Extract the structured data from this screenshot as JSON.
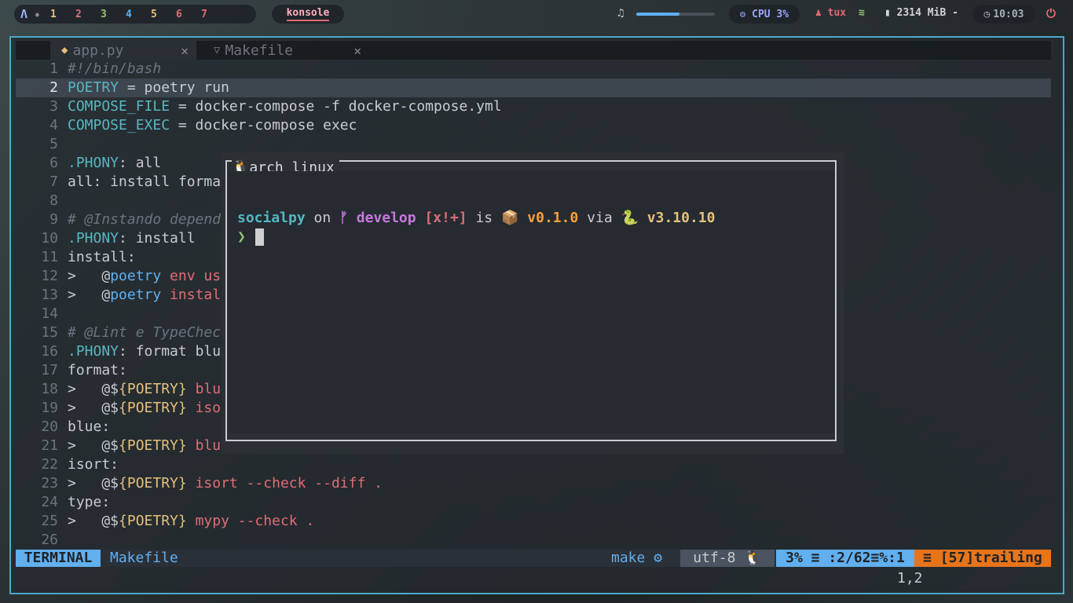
{
  "topbar": {
    "workspaces": [
      "1",
      "2",
      "3",
      "4",
      "5",
      "6",
      "7"
    ],
    "workspace_colors": [
      "#e5c07b",
      "#e06c75",
      "#98c379",
      "#61afef",
      "#e5c07b",
      "#e06c75",
      "#e06c75"
    ],
    "window_title": "konsole",
    "volume_level": 0.55,
    "cpu": "CPU 3%",
    "user": "tux",
    "memory": "2314 MiB -",
    "time": "10:03"
  },
  "editor": {
    "tabs": [
      {
        "label": "app.py",
        "icon": "python-icon"
      },
      {
        "label": "Makefile",
        "icon": "makefile-icon"
      }
    ],
    "lines": [
      {
        "n": "1",
        "segs": [
          {
            "t": "#!/bin/bash",
            "c": "cm"
          }
        ]
      },
      {
        "n": "2",
        "cur": true,
        "segs": [
          {
            "t": "POETRY",
            "c": "vr"
          },
          {
            "t": " = poetry run",
            "c": "pl"
          }
        ]
      },
      {
        "n": "3",
        "segs": [
          {
            "t": "COMPOSE_FILE",
            "c": "vr"
          },
          {
            "t": " = docker-compose -f docker-compose.yml",
            "c": "pl"
          }
        ]
      },
      {
        "n": "4",
        "segs": [
          {
            "t": "COMPOSE_EXEC",
            "c": "vr"
          },
          {
            "t": " = docker-compose exec",
            "c": "pl"
          }
        ]
      },
      {
        "n": "5",
        "segs": []
      },
      {
        "n": "6",
        "segs": [
          {
            "t": ".PHONY",
            "c": "vr"
          },
          {
            "t": ": all",
            "c": "pl"
          }
        ]
      },
      {
        "n": "7",
        "segs": [
          {
            "t": "all: install forma",
            "c": "pl"
          }
        ]
      },
      {
        "n": "8",
        "segs": []
      },
      {
        "n": "9",
        "segs": [
          {
            "t": "# @Instando depend",
            "c": "cm"
          }
        ]
      },
      {
        "n": "10",
        "segs": [
          {
            "t": ".PHONY",
            "c": "vr"
          },
          {
            "t": ": install",
            "c": "pl"
          }
        ]
      },
      {
        "n": "11",
        "segs": [
          {
            "t": "install:",
            "c": "pl"
          }
        ]
      },
      {
        "n": "12",
        "segs": [
          {
            "t": ">   @",
            "c": "pl"
          },
          {
            "t": "poetry",
            "c": "fn"
          },
          {
            "t": " env us",
            "c": "rd"
          }
        ]
      },
      {
        "n": "13",
        "segs": [
          {
            "t": ">   @",
            "c": "pl"
          },
          {
            "t": "poetry",
            "c": "fn"
          },
          {
            "t": " instal",
            "c": "rd"
          }
        ]
      },
      {
        "n": "14",
        "segs": []
      },
      {
        "n": "15",
        "segs": [
          {
            "t": "# @Lint e TypeChec",
            "c": "cm"
          }
        ]
      },
      {
        "n": "16",
        "segs": [
          {
            "t": ".PHONY",
            "c": "vr"
          },
          {
            "t": ": format blu",
            "c": "pl"
          }
        ]
      },
      {
        "n": "17",
        "segs": [
          {
            "t": "format:",
            "c": "pl"
          }
        ]
      },
      {
        "n": "18",
        "segs": [
          {
            "t": ">   @$",
            "c": "pl"
          },
          {
            "t": "{POETRY}",
            "c": "yl"
          },
          {
            "t": " blu",
            "c": "rd"
          }
        ]
      },
      {
        "n": "19",
        "segs": [
          {
            "t": ">   @$",
            "c": "pl"
          },
          {
            "t": "{POETRY}",
            "c": "yl"
          },
          {
            "t": " iso",
            "c": "rd"
          }
        ]
      },
      {
        "n": "20",
        "segs": [
          {
            "t": "blue:",
            "c": "pl"
          }
        ]
      },
      {
        "n": "21",
        "segs": [
          {
            "t": ">   @$",
            "c": "pl"
          },
          {
            "t": "{POETRY}",
            "c": "yl"
          },
          {
            "t": " blu",
            "c": "rd"
          }
        ]
      },
      {
        "n": "22",
        "segs": [
          {
            "t": "isort:",
            "c": "pl"
          }
        ]
      },
      {
        "n": "23",
        "segs": [
          {
            "t": ">   @$",
            "c": "pl"
          },
          {
            "t": "{POETRY}",
            "c": "yl"
          },
          {
            "t": " isort --check --diff .",
            "c": "rd"
          }
        ]
      },
      {
        "n": "24",
        "segs": [
          {
            "t": "type:",
            "c": "pl"
          }
        ]
      },
      {
        "n": "25",
        "segs": [
          {
            "t": ">   @$",
            "c": "pl"
          },
          {
            "t": "{POETRY}",
            "c": "yl"
          },
          {
            "t": " mypy --check .",
            "c": "rd"
          }
        ]
      },
      {
        "n": "26",
        "segs": []
      }
    ]
  },
  "floating_terminal": {
    "title": "arch linux",
    "project": "socialpy",
    "on": "on",
    "branch_icon": "ᚠ",
    "branch": "develop",
    "git_status": "[x!+]",
    "is": "is",
    "package_icon": "📦",
    "version": "v0.1.0",
    "via": "via",
    "python_icon": "🐍",
    "python_version": "v3.10.10",
    "prompt_char": "❯"
  },
  "statusline": {
    "mode": "TERMINAL",
    "filename": "Makefile",
    "filetype": "make",
    "encoding": "utf-8",
    "position": "3% ≡ :2/62≡%:1",
    "warning": "≡ [57]trailing",
    "ruler": "1,2"
  }
}
